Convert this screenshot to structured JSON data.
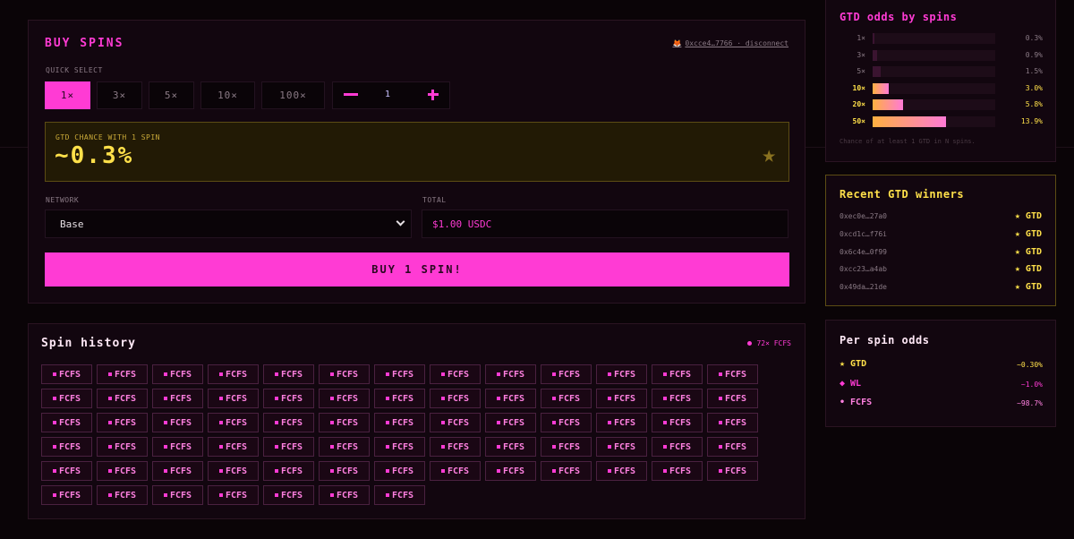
{
  "buy": {
    "title": "BUY SPINS",
    "wallet": "0xcce4…7766 · disconnect",
    "quick_select_label": "QUICK SELECT",
    "quick_select": [
      "1×",
      "3×",
      "5×",
      "10×",
      "100×"
    ],
    "quick_select_active": 0,
    "quantity": "1",
    "chance_label": "GTD CHANCE WITH 1 SPIN",
    "chance_value": "~0.3%",
    "network_label": "NETWORK",
    "network_value": "Base",
    "total_label": "TOTAL",
    "total_value": "$1.00 USDC",
    "buy_button": "BUY 1 SPIN!"
  },
  "history": {
    "title": "Spin history",
    "count": "72× FCFS",
    "chip_label": "FCFS",
    "chip_count": 72
  },
  "odds": {
    "title": "GTD odds by spins",
    "rows": [
      {
        "label": "1×",
        "pct": "0.3%",
        "value": 0.3,
        "highlight": false
      },
      {
        "label": "3×",
        "pct": "0.9%",
        "value": 0.9,
        "highlight": false
      },
      {
        "label": "5×",
        "pct": "1.5%",
        "value": 1.5,
        "highlight": false
      },
      {
        "label": "10×",
        "pct": "3.0%",
        "value": 3.0,
        "highlight": true
      },
      {
        "label": "20×",
        "pct": "5.8%",
        "value": 5.8,
        "highlight": true
      },
      {
        "label": "50×",
        "pct": "13.9%",
        "value": 13.9,
        "highlight": true
      }
    ],
    "note": "Chance of at least 1 GTD in N spins."
  },
  "winners": {
    "title": "Recent GTD winners",
    "badge": "★ GTD",
    "rows": [
      "0xec0e…27a0",
      "0xcd1c…f76i",
      "0x6c4e…0f99",
      "0xcc23…a4ab",
      "0x49da…21de"
    ]
  },
  "perspin": {
    "title": "Per spin odds",
    "rows": [
      {
        "name": "★ GTD",
        "value": "~0.30%",
        "color": "#ffe04a"
      },
      {
        "name": "◆ WL",
        "value": "~1.0%",
        "color": "#ff3bd4"
      },
      {
        "name": "• FCFS",
        "value": "~98.7%",
        "color": "#ff80e0"
      }
    ]
  }
}
